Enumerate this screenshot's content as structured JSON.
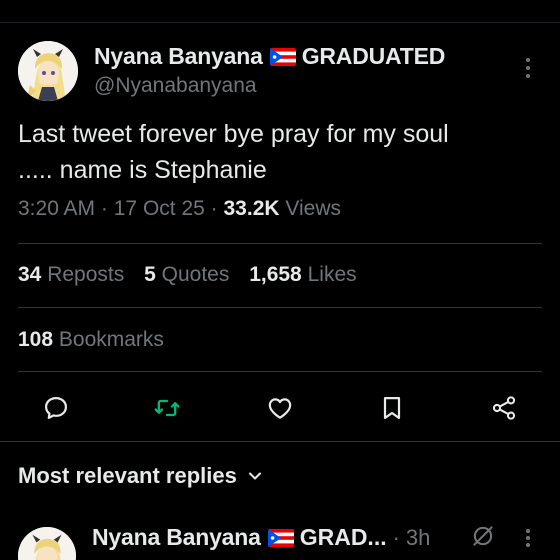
{
  "tweet": {
    "author": {
      "display_name": "Nyana Banyana",
      "flag_icon": "puerto-rico-flag-icon",
      "name_suffix": "GRADUATED",
      "handle": "@Nyanabanyana"
    },
    "text_line1": "Last tweet forever bye pray for my soul",
    "text_line2": "..... name is Stephanie",
    "time": "3:20 AM",
    "date": "17 Oct 25",
    "views_count": "33.2K",
    "views_label": "Views",
    "separator": "·"
  },
  "stats": {
    "reposts_count": "34",
    "reposts_label": "Reposts",
    "quotes_count": "5",
    "quotes_label": "Quotes",
    "likes_count": "1,658",
    "likes_label": "Likes",
    "bookmarks_count": "108",
    "bookmarks_label": "Bookmarks"
  },
  "actions": [
    {
      "icon": "reply-icon"
    },
    {
      "icon": "repost-icon",
      "color": "#00ba7c"
    },
    {
      "icon": "like-icon"
    },
    {
      "icon": "bookmark-icon"
    },
    {
      "icon": "share-icon"
    }
  ],
  "replies": {
    "sort_label": "Most relevant replies",
    "first_reply": {
      "display_name": "Nyana Banyana",
      "flag_icon": "puerto-rico-flag-icon",
      "name_suffix": "GRAD...",
      "separator": "·",
      "time": "3h",
      "grok_icon": "grok-icon"
    }
  },
  "colors": {
    "background": "#000000",
    "primary_text": "#e7e9ea",
    "secondary_text": "#71767b",
    "divider": "#2f3336",
    "repost_accent": "#00ba7c"
  }
}
